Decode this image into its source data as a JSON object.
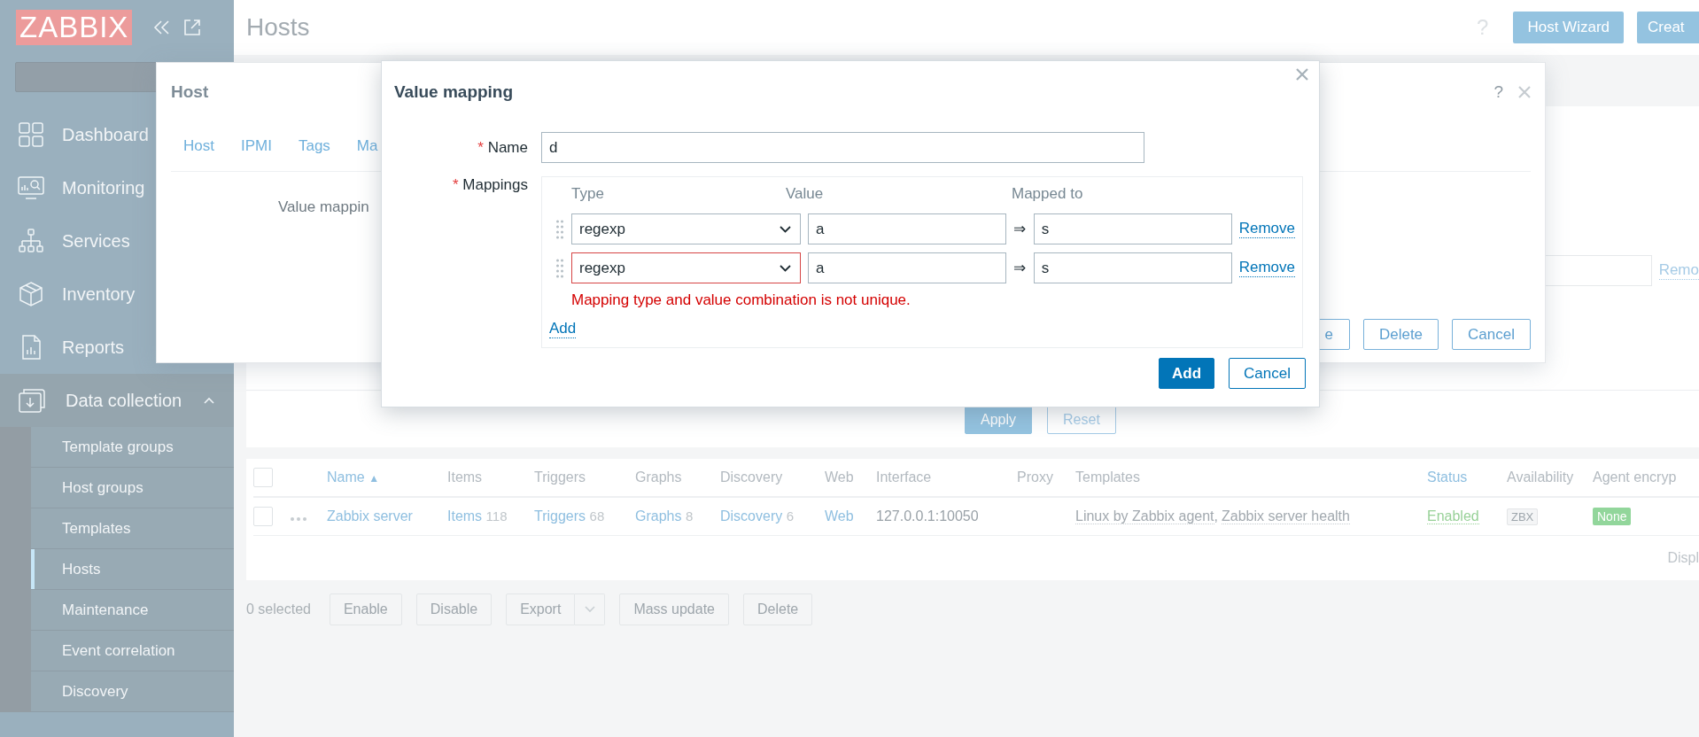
{
  "sidebar": {
    "logo": "ZABBIX",
    "menu": [
      {
        "label": "Dashboard",
        "expanded": false
      },
      {
        "label": "Monitoring",
        "expanded": false
      },
      {
        "label": "Services",
        "expanded": false
      },
      {
        "label": "Inventory",
        "expanded": false
      },
      {
        "label": "Reports",
        "expanded": false
      },
      {
        "label": "Data collection",
        "expanded": true,
        "children": [
          {
            "label": "Template groups",
            "selected": false
          },
          {
            "label": "Host groups",
            "selected": false
          },
          {
            "label": "Templates",
            "selected": false
          },
          {
            "label": "Hosts",
            "selected": true
          },
          {
            "label": "Maintenance",
            "selected": false
          },
          {
            "label": "Event correlation",
            "selected": false
          },
          {
            "label": "Discovery",
            "selected": false
          }
        ]
      }
    ]
  },
  "header": {
    "title": "Hosts",
    "help": "?",
    "buttons": [
      "Host Wizard",
      "Creat"
    ]
  },
  "filter": {
    "link": "Remo",
    "buttons": [
      {
        "label": "Apply",
        "kind": "primary"
      },
      {
        "label": "Reset",
        "kind": "secondary"
      }
    ]
  },
  "table": {
    "all_checked": false,
    "columns": [
      {
        "label": "Name",
        "sortable": true,
        "sort_icon": "▲"
      },
      {
        "label": "Items",
        "sortable": false
      },
      {
        "label": "Triggers",
        "sortable": false
      },
      {
        "label": "Graphs",
        "sortable": false
      },
      {
        "label": "Discovery",
        "sortable": false
      },
      {
        "label": "Web",
        "sortable": false
      },
      {
        "label": "Interface",
        "sortable": false
      },
      {
        "label": "Proxy",
        "sortable": false
      },
      {
        "label": "Templates",
        "sortable": false
      },
      {
        "label": "Status",
        "sortable": true
      },
      {
        "label": "Availability",
        "sortable": false
      },
      {
        "label": "Agent encryp",
        "sortable": false
      }
    ],
    "rows": [
      {
        "checked": false,
        "name": "Zabbix server",
        "items": {
          "label": "Items",
          "count": "118"
        },
        "triggers": {
          "label": "Triggers",
          "count": "68"
        },
        "graphs": {
          "label": "Graphs",
          "count": "8"
        },
        "discovery": {
          "label": "Discovery",
          "count": "6"
        },
        "web": "Web",
        "interface": "127.0.0.1:10050",
        "templates": [
          "Linux by Zabbix agent",
          "Zabbix server health"
        ],
        "template_separator": ",",
        "status": "Enabled",
        "availability": "ZBX",
        "encryption": "None"
      }
    ],
    "footer": "Displ"
  },
  "actions": {
    "selected": "0 selected",
    "buttons": [
      {
        "label": "Enable",
        "kind": "plain"
      },
      {
        "label": "Disable",
        "kind": "plain"
      },
      {
        "label": "Export",
        "kind": "split"
      },
      {
        "label": "Mass update",
        "kind": "plain"
      },
      {
        "label": "Delete",
        "kind": "plain"
      }
    ]
  },
  "host_dialog": {
    "title": "Host",
    "help": "?",
    "tabs": [
      {
        "label": "Host",
        "selected": false
      },
      {
        "label": "IPMI",
        "selected": false
      },
      {
        "label": "Tags",
        "selected": false
      },
      {
        "label": "Ma",
        "selected": false
      }
    ],
    "field_label": "Value mappin",
    "buttons": [
      "e",
      "Delete",
      "Cancel"
    ]
  },
  "value_mapping_dialog": {
    "title": "Value mapping",
    "name": {
      "label": "Name",
      "required_mark": "*",
      "value": "d"
    },
    "mappings": {
      "label": "Mappings",
      "required_mark": "*",
      "columns": [
        "Type",
        "Value",
        "Mapped to"
      ],
      "rows": [
        {
          "type": "regexp",
          "value": "a",
          "arrow": "⇒",
          "mapped_to": "s",
          "invalid": false,
          "remove": "Remove"
        },
        {
          "type": "regexp",
          "value": "a",
          "arrow": "⇒",
          "mapped_to": "s",
          "invalid": true,
          "remove": "Remove"
        }
      ],
      "error": "Mapping type and value combination is not unique.",
      "add": "Add"
    },
    "buttons": [
      {
        "label": "Add",
        "kind": "primary"
      },
      {
        "label": "Cancel",
        "kind": "secondary"
      }
    ]
  }
}
